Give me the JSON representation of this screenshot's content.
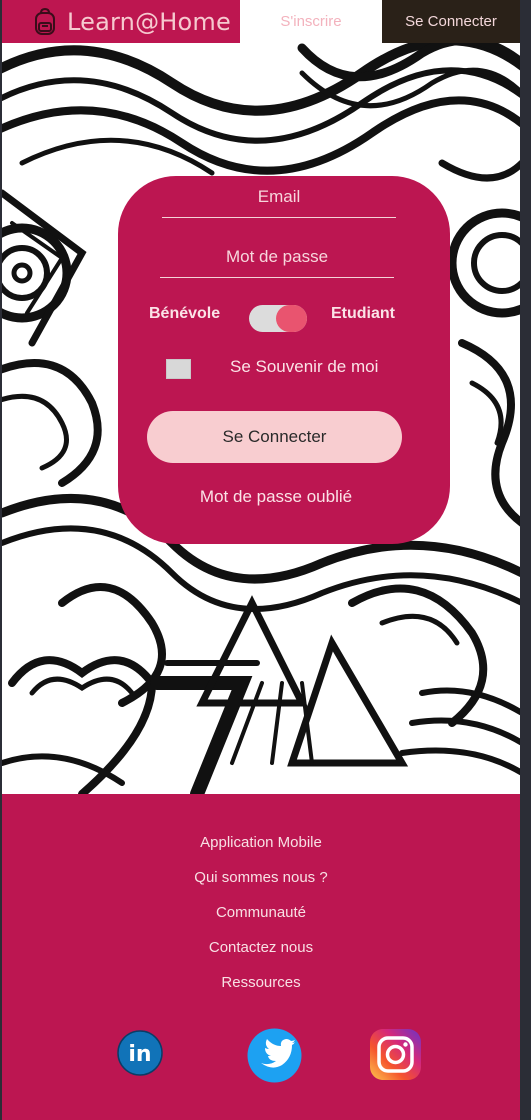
{
  "header": {
    "brand_name": "Learn@Home",
    "brand_icon": "backpack-icon",
    "nav_signup": "S'inscrire",
    "nav_login": "Se Connecter"
  },
  "login": {
    "email_placeholder": "Email",
    "password_placeholder": "Mot de passe",
    "toggle_left_label": "Bénévole",
    "toggle_right_label": "Etudiant",
    "toggle_state": "Etudiant",
    "remember_label": "Se Souvenir de moi",
    "remember_checked": false,
    "submit_label": "Se Connecter",
    "forgot_label": "Mot de passe oublié"
  },
  "footer": {
    "links": [
      "Application Mobile",
      "Qui sommes nous ?",
      "Communauté",
      "Contactez nous",
      "Ressources"
    ],
    "social": [
      {
        "name": "linkedin-icon",
        "label": "in"
      },
      {
        "name": "twitter-icon"
      },
      {
        "name": "instagram-icon"
      }
    ]
  },
  "colors": {
    "brand": "#bd1650",
    "brand_text": "#f6c9cf",
    "nav_login_bg": "#2a2118",
    "button_bg": "#f8cdd0",
    "toggle_knob": "#e9546f"
  }
}
